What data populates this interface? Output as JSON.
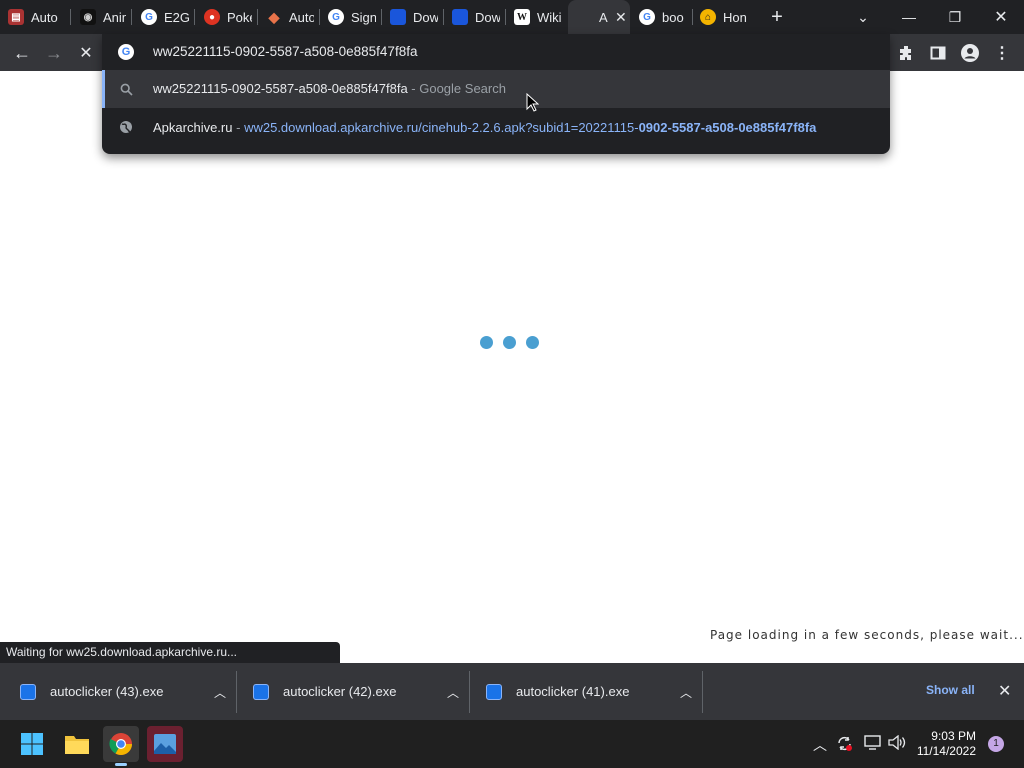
{
  "tabs": [
    {
      "title": "Auto",
      "icon": "clipboard-icon",
      "color": "#c63"
    },
    {
      "title": "Anim",
      "icon": "github-icon",
      "color": "#222"
    },
    {
      "title": "E2G",
      "icon": "google-icon",
      "color": "#fff"
    },
    {
      "title": "Poke",
      "icon": "pokeball-icon",
      "color": "#d32"
    },
    {
      "title": "Auto",
      "icon": "diamond-icon",
      "color": "#e86"
    },
    {
      "title": "Sign",
      "icon": "google-icon",
      "color": "#fff"
    },
    {
      "title": "Dow",
      "icon": "blue-square-icon",
      "color": "#1a56db"
    },
    {
      "title": "Dow",
      "icon": "blue-square-icon",
      "color": "#1a56db"
    },
    {
      "title": "Wiki",
      "icon": "wikipedia-icon",
      "color": "#fff"
    },
    {
      "title": "A",
      "icon": "loading-icon",
      "color": "#35363a"
    },
    {
      "title": "boo",
      "icon": "google-icon",
      "color": "#fff"
    },
    {
      "title": "Hon",
      "icon": "home-icon",
      "color": "#f4b400"
    }
  ],
  "omnibox": {
    "input_value": "ww25221115-0902-5587-a508-0e885f47f8fa",
    "suggestion_search": {
      "query": "ww25221115-0902-5587-a508-0e885f47f8fa",
      "suffix": "- Google Search"
    },
    "suggestion_site": {
      "site": "Apkarchive.ru",
      "sep": "-",
      "url_plain": "ww25.download.apkarchive.ru/cinehub-2.2.6.apk?subid1=20221115-",
      "url_bold": "0902-5587-a508-0e885f47f8fa"
    }
  },
  "page": {
    "loading_message": "Page loading in a few seconds, please wait..."
  },
  "status_bar": {
    "text": "Waiting for ww25.download.apkarchive.ru..."
  },
  "downloads": {
    "items": [
      {
        "name": "autoclicker (43).exe"
      },
      {
        "name": "autoclicker (42).exe"
      },
      {
        "name": "autoclicker (41).exe"
      }
    ],
    "show_all": "Show all"
  },
  "taskbar": {
    "time": "9:03 PM",
    "date": "11/14/2022",
    "notifications": "1"
  }
}
